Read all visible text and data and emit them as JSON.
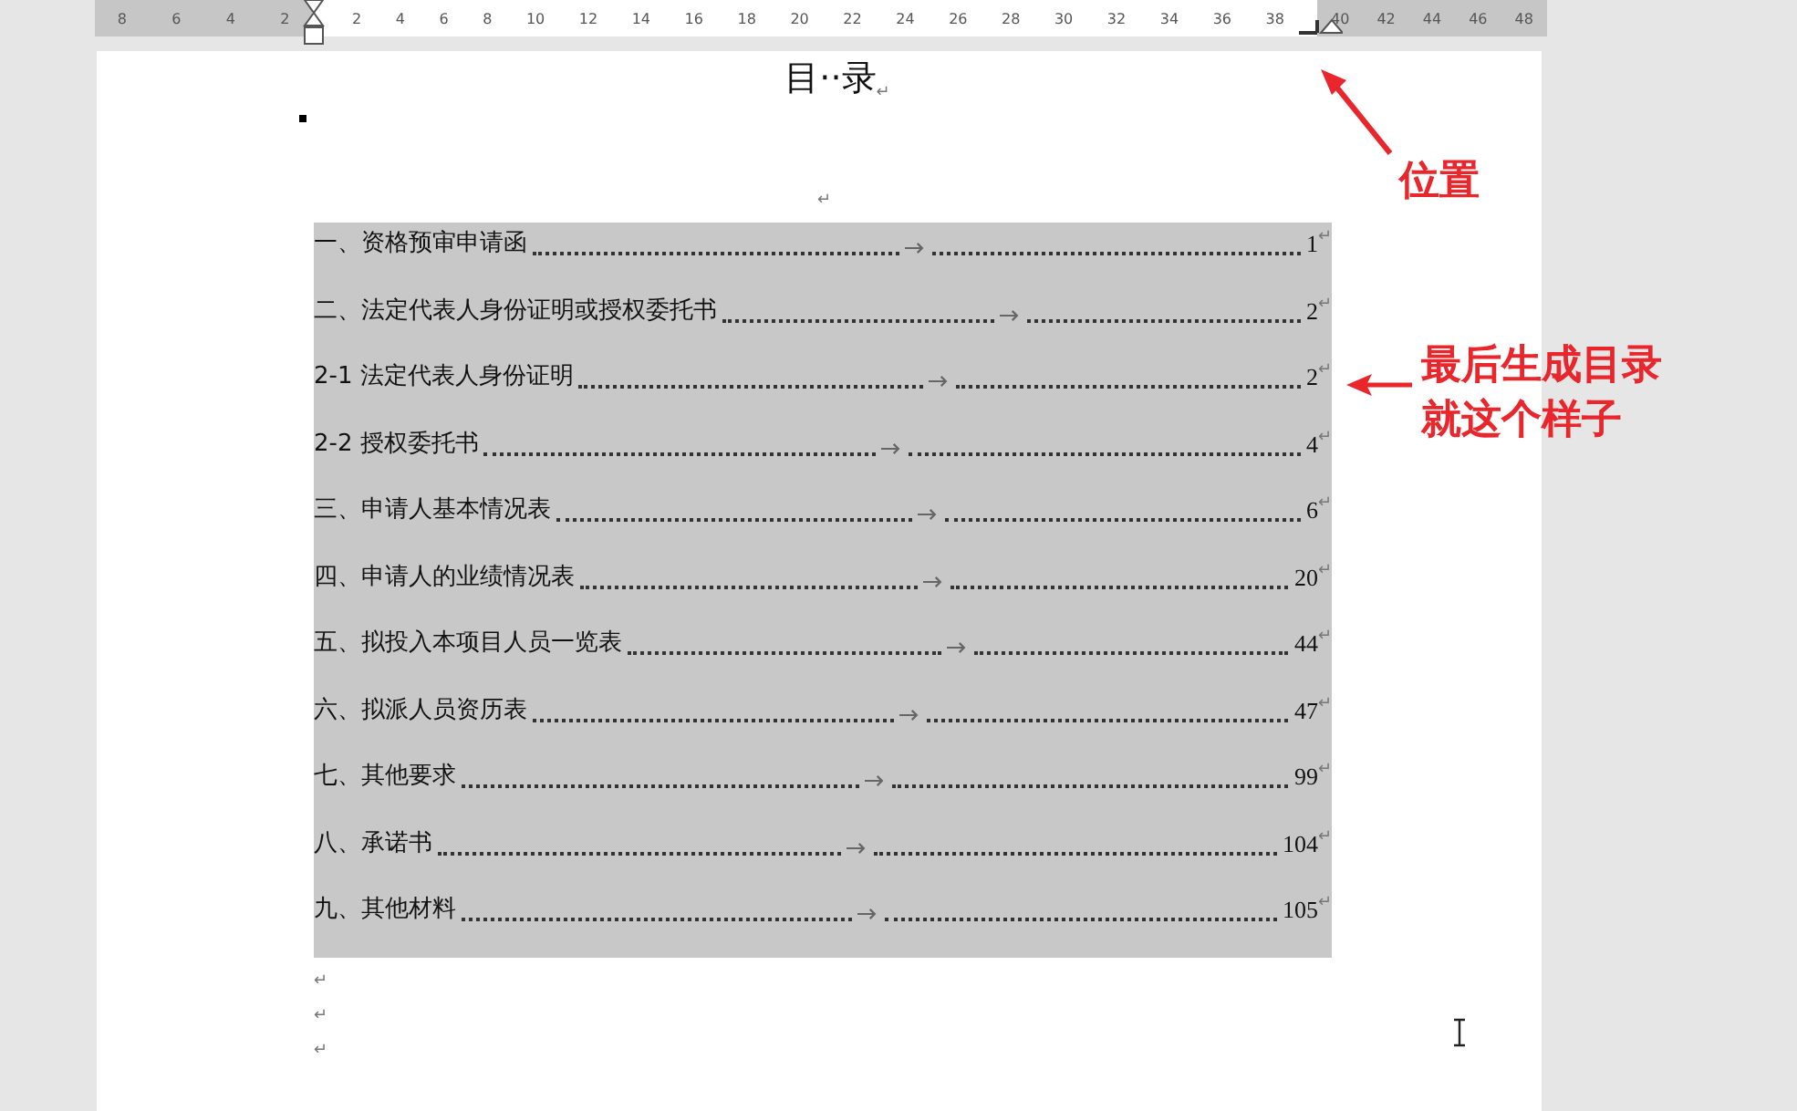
{
  "ruler": {
    "left_numbers": [
      "8",
      "6",
      "4",
      "2"
    ],
    "numbers": [
      "2",
      "4",
      "6",
      "8",
      "10",
      "12",
      "14",
      "16",
      "18",
      "20",
      "22",
      "24",
      "26",
      "28",
      "30",
      "32",
      "34",
      "36",
      "38"
    ],
    "right_numbers": [
      "40",
      "42",
      "44",
      "46",
      "48"
    ]
  },
  "document": {
    "title": "目··录",
    "title_mark": "↵",
    "blank_mark": "↵",
    "entries": [
      {
        "title": "一、资格预审申请函",
        "page": "1",
        "mark": "↵"
      },
      {
        "title": "二、法定代表人身份证明或授权委托书",
        "page": "2",
        "mark": "↵"
      },
      {
        "title": "2-1 法定代表人身份证明",
        "page": "2",
        "mark": "↵"
      },
      {
        "title": "2-2 授权委托书",
        "page": "4",
        "mark": "↵"
      },
      {
        "title": "三、申请人基本情况表",
        "page": "6",
        "mark": "↵"
      },
      {
        "title": "四、申请人的业绩情况表",
        "page": "20",
        "mark": "↵"
      },
      {
        "title": "五、拟投入本项目人员一览表",
        "page": "44",
        "mark": "↵"
      },
      {
        "title": "六、拟派人员资历表",
        "page": "47",
        "mark": "↵"
      },
      {
        "title": "七、其他要求",
        "page": "99",
        "mark": "↵"
      },
      {
        "title": "八、承诺书",
        "page": "104",
        "mark": "↵"
      },
      {
        "title": "九、其他材料",
        "page": "105",
        "mark": "↵"
      }
    ],
    "trailing_marks": [
      "↵",
      "↵",
      "↵"
    ]
  },
  "annotations": [
    {
      "lines": [
        "位置"
      ]
    },
    {
      "lines": [
        "最后生成目录",
        "就这个样子"
      ]
    }
  ]
}
